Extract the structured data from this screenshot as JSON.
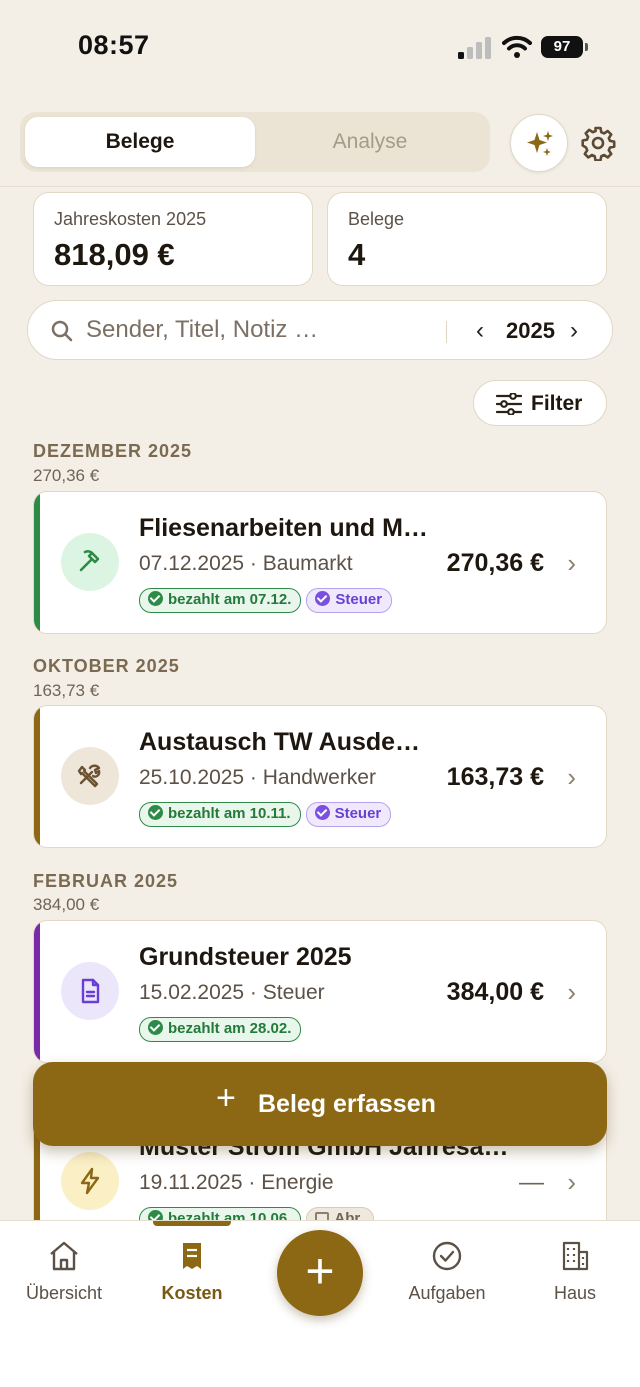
{
  "status_bar": {
    "time": "08:57",
    "battery": "97"
  },
  "segmented": {
    "tabs": [
      {
        "label": "Belege",
        "active": true
      },
      {
        "label": "Analyse",
        "active": false
      }
    ]
  },
  "stats": [
    {
      "label": "Jahreskosten 2025",
      "value": "818,09 €"
    },
    {
      "label": "Belege",
      "value": "4"
    }
  ],
  "search": {
    "placeholder": "Sender, Titel, Notiz …",
    "year": "2025",
    "prev": "‹",
    "next": "›"
  },
  "filter_label": "Filter",
  "groups": [
    {
      "month": "DEZEMBER 2025",
      "sum": "270,36 €",
      "items": [
        {
          "title": "Fliesenarbeiten und M…",
          "subtitle": "07.12.2025 · Baumarkt",
          "amount": "270,36 €",
          "paid_label": "bezahlt am 07.12.",
          "tag": "Steuer",
          "icon": "hammer-icon",
          "accent": "#2e8b47"
        }
      ]
    },
    {
      "month": "OKTOBER 2025",
      "sum": "163,73 €",
      "items": [
        {
          "title": "Austausch TW Ausdeh…",
          "subtitle": "25.10.2025 · Handwerker",
          "amount": "163,73 €",
          "paid_label": "bezahlt am 10.11.",
          "tag": "Steuer",
          "icon": "tools-icon",
          "accent": "#8c6815"
        }
      ]
    },
    {
      "month": "FEBRUAR 2025",
      "sum": "384,00 €",
      "items": [
        {
          "title": "Grundsteuer 2025",
          "subtitle": "15.02.2025 · Steuer",
          "amount": "384,00 €",
          "paid_label": "bezahlt am 28.02.",
          "icon": "document-icon",
          "accent": "#7a2aa8"
        },
        {
          "title": "Muster Strom GmbH Jahresa…",
          "subtitle": "19.11.2025 · Energie",
          "amount": "—",
          "paid_label": "bezahlt am 10.06.",
          "tag": "Abr.",
          "icon": "lightning-icon",
          "accent": "#8c6815"
        }
      ]
    }
  ],
  "cta": {
    "plus": "+",
    "label": "Beleg erfassen"
  },
  "fab": {
    "plus": "+"
  },
  "chevron": "›",
  "tabbar": [
    {
      "label": "Übersicht",
      "icon": "home-icon",
      "active": false
    },
    {
      "label": "Kosten",
      "icon": "receipt-icon",
      "active": true
    },
    {
      "label": "Aufgaben",
      "icon": "check-circle-icon",
      "active": false
    },
    {
      "label": "Haus",
      "icon": "building-icon",
      "active": false
    }
  ]
}
